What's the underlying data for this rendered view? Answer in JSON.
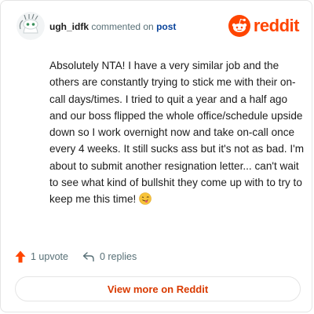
{
  "header": {
    "username": "ugh_idfk",
    "action_text": "commented on",
    "post_link": "post"
  },
  "brand": {
    "name": "reddit",
    "color": "#ff4500"
  },
  "comment": {
    "text": "Absolutely NTA! I have a very similar job and the others are constantly trying to stick me with their on-call days/times. I tried to quit a year and a half ago and our boss flipped the whole office/schedule upside down so I work overnight now and take on-call once every 4 weeks. It still sucks ass but it's not as bad. I'm about to submit another resignation letter... can't wait to see what kind of bullshit they come up with to try to keep me this time!",
    "emoji": "face-with-tongue-winking-icon"
  },
  "footer": {
    "upvotes": "1 upvote",
    "replies": "0 replies"
  },
  "view_more_label": "View more on Reddit"
}
